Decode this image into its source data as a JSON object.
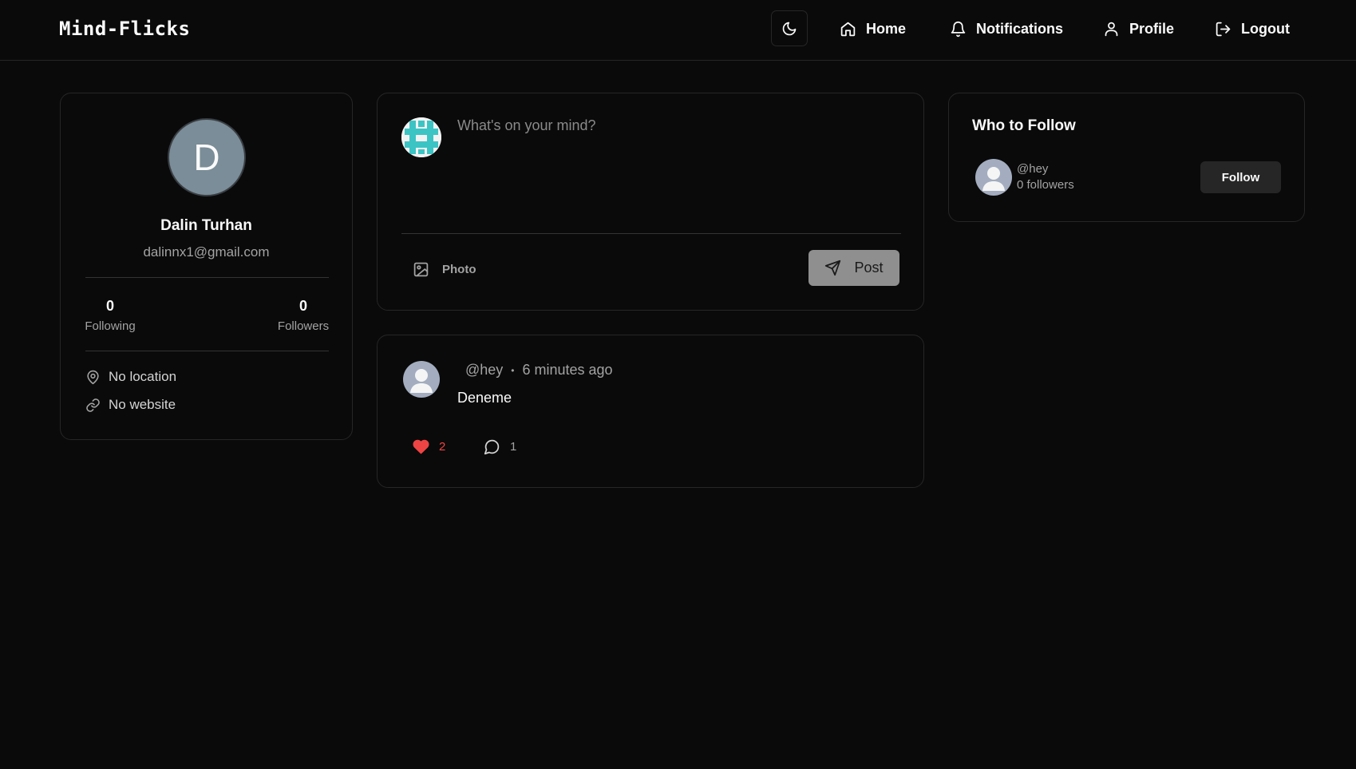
{
  "header": {
    "brand": "Mind-Flicks",
    "theme_icon": "moon-icon",
    "nav": [
      {
        "label": "Home",
        "icon": "home-icon"
      },
      {
        "label": "Notifications",
        "icon": "bell-icon"
      },
      {
        "label": "Profile",
        "icon": "user-icon"
      },
      {
        "label": "Logout",
        "icon": "logout-icon"
      }
    ]
  },
  "profile": {
    "initial": "D",
    "name": "Dalin Turhan",
    "email": "dalinnx1@gmail.com",
    "following_count": "0",
    "following_label": "Following",
    "followers_count": "0",
    "followers_label": "Followers",
    "location": "No location",
    "website": "No website"
  },
  "composer": {
    "placeholder": "What's on your mind?",
    "photo_label": "Photo",
    "post_label": "Post"
  },
  "feed": [
    {
      "handle": "@hey",
      "separator": "•",
      "time": "6 minutes ago",
      "text": "Deneme",
      "likes": "2",
      "comments": "1"
    }
  ],
  "who_to_follow": {
    "title": "Who to Follow",
    "users": [
      {
        "handle": "@hey",
        "followers": "0 followers",
        "button": "Follow"
      }
    ]
  },
  "colors": {
    "background": "#0a0a0a",
    "border": "#262626",
    "like": "#ef4444",
    "avatar": "#7a8d98"
  }
}
